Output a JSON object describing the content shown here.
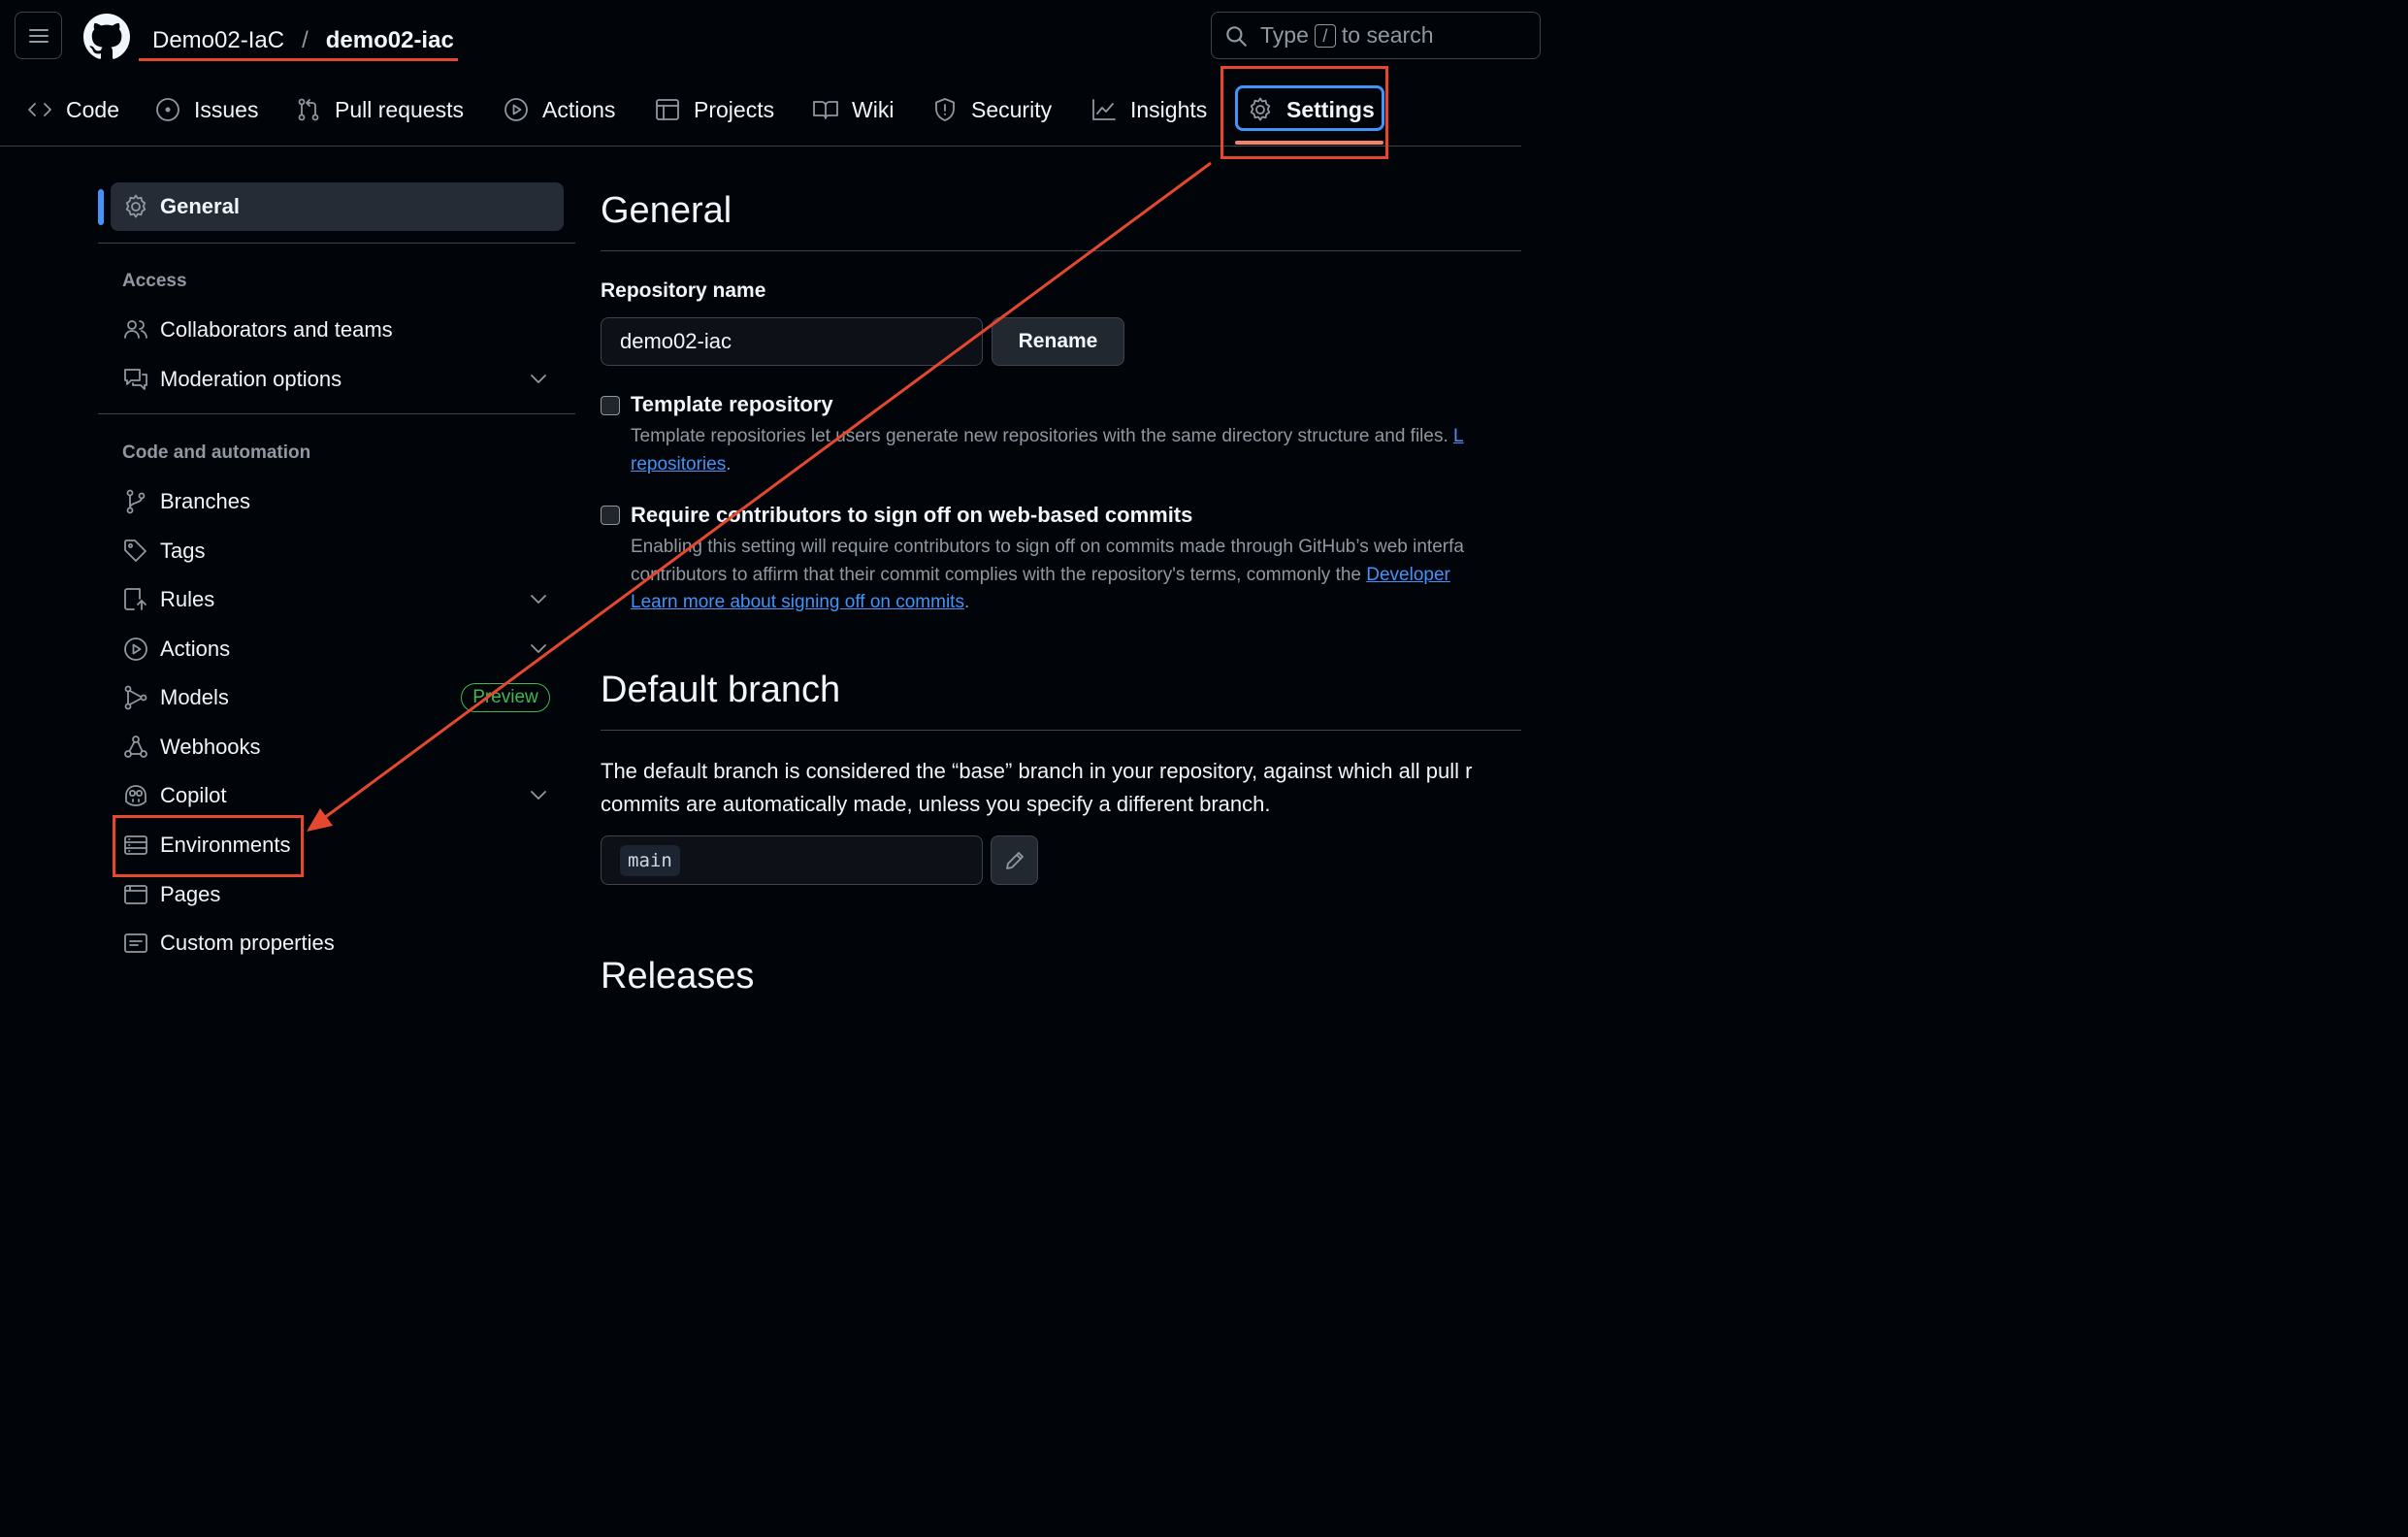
{
  "header": {
    "owner": "Demo02-IaC",
    "separator": "/",
    "repo": "demo02-iac",
    "search": {
      "prefix": "Type",
      "key": "/",
      "suffix": "to search"
    }
  },
  "repo_nav": {
    "tabs": [
      {
        "label": "Code",
        "icon": "code-icon"
      },
      {
        "label": "Issues",
        "icon": "issue-icon"
      },
      {
        "label": "Pull requests",
        "icon": "pull-request-icon"
      },
      {
        "label": "Actions",
        "icon": "play-icon"
      },
      {
        "label": "Projects",
        "icon": "table-icon"
      },
      {
        "label": "Wiki",
        "icon": "book-icon"
      },
      {
        "label": "Security",
        "icon": "shield-icon"
      },
      {
        "label": "Insights",
        "icon": "graph-icon"
      },
      {
        "label": "Settings",
        "icon": "gear-icon",
        "selected": true
      }
    ]
  },
  "sidebar": {
    "general": "General",
    "access_heading": "Access",
    "access_items": [
      {
        "label": "Collaborators and teams"
      },
      {
        "label": "Moderation options",
        "expandable": true
      }
    ],
    "code_heading": "Code and automation",
    "code_items": [
      {
        "label": "Branches"
      },
      {
        "label": "Tags"
      },
      {
        "label": "Rules",
        "expandable": true
      },
      {
        "label": "Actions",
        "expandable": true
      },
      {
        "label": "Models",
        "badge": "Preview"
      },
      {
        "label": "Webhooks"
      },
      {
        "label": "Copilot",
        "expandable": true
      },
      {
        "label": "Environments",
        "highlighted": true
      },
      {
        "label": "Pages"
      },
      {
        "label": "Custom properties"
      }
    ]
  },
  "main": {
    "title": "General",
    "repo_name_label": "Repository name",
    "repo_name_value": "demo02-iac",
    "rename_button": "Rename",
    "template": {
      "title": "Template repository",
      "desc_line1": "Template repositories let users generate new repositories with the same directory structure and files.",
      "desc_link_tail": "L",
      "desc_link2": "repositories",
      "desc_end": "."
    },
    "signoff": {
      "title": "Require contributors to sign off on web-based commits",
      "desc_line1": "Enabling this setting will require contributors to sign off on commits made through GitHub’s web interfa",
      "desc_line2": "contributors to affirm that their commit complies with the repository's terms, commonly the",
      "desc_line2_link": "Developer",
      "learn_more": "Learn more about signing off on commits",
      "learn_end": "."
    },
    "default_branch": {
      "title": "Default branch",
      "desc_line1": "The default branch is considered the “base” branch in your repository, against which all pull r",
      "desc_line2": "commits are automatically made, unless you specify a different branch.",
      "branch": "main"
    },
    "next_section": "Releases"
  },
  "colors": {
    "background": "#010409",
    "annotation": "#e5482f",
    "accent": "#4493f8",
    "tab_underline": "#f78166",
    "preview_badge": "#3fb950"
  }
}
